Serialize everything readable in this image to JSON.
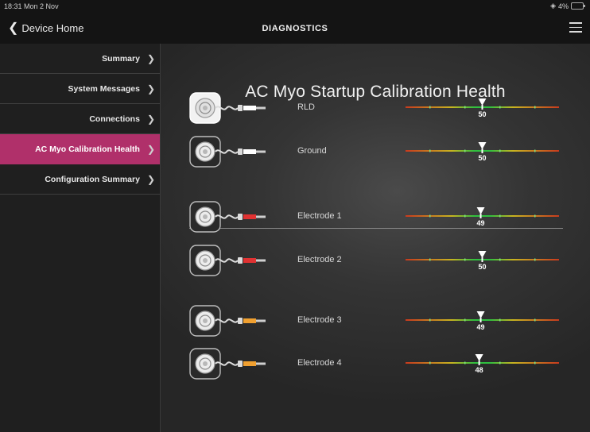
{
  "status": {
    "time": "18:31",
    "date": "Mon 2 Nov",
    "battery": "4%"
  },
  "nav": {
    "back_label": "Device Home",
    "title": "DIAGNOSTICS"
  },
  "sidebar": {
    "items": [
      {
        "label": "Summary",
        "active": false
      },
      {
        "label": "System Messages",
        "active": false
      },
      {
        "label": "Connections",
        "active": false
      },
      {
        "label": "AC Myo Calibration Health",
        "active": true
      },
      {
        "label": "Configuration Summary",
        "active": false
      }
    ]
  },
  "main": {
    "title": "AC Myo Startup Calibration Health",
    "rows": [
      {
        "label": "RLD",
        "value": 50,
        "tip_color": "#ffffff",
        "highlighted": true
      },
      {
        "label": "Ground",
        "value": 50,
        "tip_color": "#ffffff",
        "highlighted": false
      },
      {
        "label": "Electrode 1",
        "value": 49,
        "tip_color": "#e03232",
        "highlighted": false
      },
      {
        "label": "Electrode 2",
        "value": 50,
        "tip_color": "#e03232",
        "highlighted": false
      },
      {
        "label": "Electrode 3",
        "value": 49,
        "tip_color": "#f0a030",
        "highlighted": false
      },
      {
        "label": "Electrode 4",
        "value": 48,
        "tip_color": "#f0a030",
        "highlighted": false
      }
    ]
  },
  "colors": {
    "accent": "#b0306a",
    "gauge_good": "#2fbf3f",
    "gauge_warn": "#c8b420",
    "gauge_bad": "#c83a1e"
  }
}
